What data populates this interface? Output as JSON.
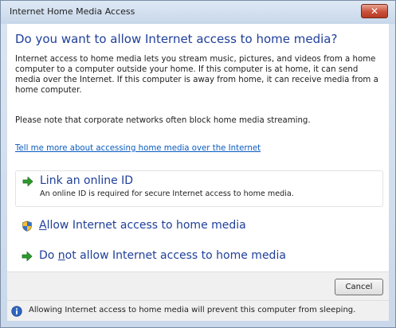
{
  "window": {
    "title": "Internet Home Media Access",
    "close_glyph": "✕"
  },
  "heading": "Do you want to allow Internet access to home media?",
  "paragraphs": [
    "Internet access to home media lets you stream music, pictures, and videos from a home computer to a computer outside your home.  If this computer is at home, it can send media over the Internet.  If this computer is away from home, it can receive media from a home computer.",
    "Please note that corporate networks often block home media streaming."
  ],
  "help_link": "Tell me more about accessing home media over the Internet",
  "options": {
    "link_id": {
      "title": "Link an online ID",
      "subtitle": "An online ID is required for secure Internet access to home media.",
      "icon": "green-arrow-icon"
    },
    "allow": {
      "accel": "A",
      "title_rest": "llow Internet access to home media",
      "icon": "uac-shield-icon"
    },
    "disallow": {
      "title_pre": "Do ",
      "accel": "n",
      "title_rest": "ot allow Internet access to home media",
      "icon": "green-arrow-icon"
    }
  },
  "buttons": {
    "cancel": "Cancel"
  },
  "footer": {
    "text": "Allowing Internet access to home media will prevent this computer from sleeping.",
    "icon": "info-icon"
  },
  "colors": {
    "heading": "#1f3f9a",
    "link": "#0a5bbf",
    "arrow": "#2e9a2e",
    "close": "#c9503a"
  }
}
